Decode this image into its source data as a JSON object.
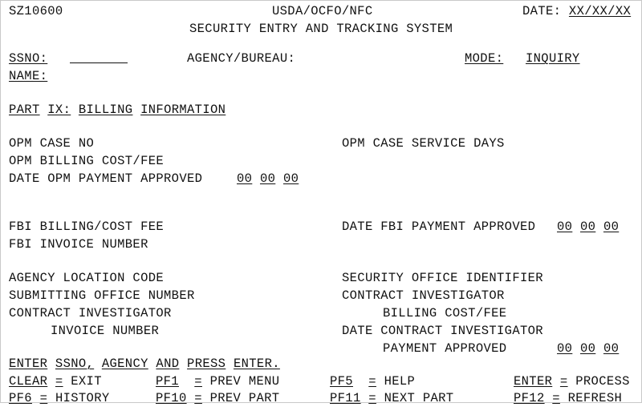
{
  "screen": {
    "program_id": "SZ10600",
    "agency_heading": "USDA/OCFO/NFC",
    "system_title": "SECURITY ENTRY AND TRACKING SYSTEM",
    "date_label": "DATE:",
    "date_value": "XX/XX/XX"
  },
  "keyfields": {
    "ssno_label": "SSNO:",
    "ssno_value": "",
    "name_label": "NAME:",
    "name_value": "",
    "agency_bureau_label": "AGENCY/BUREAU:",
    "agency_bureau_value": "",
    "mode_label": "MODE:",
    "mode_value": "INQUIRY"
  },
  "part": {
    "word1": "PART",
    "word2": "IX:",
    "word3": "BILLING",
    "word4": "INFORMATION"
  },
  "opm": {
    "case_no_label": "OPM CASE NO",
    "case_no_value": "",
    "service_days_label": "OPM CASE SERVICE DAYS",
    "service_days_value": "",
    "billing_cost_fee_label": "OPM BILLING COST/FEE",
    "billing_cost_fee_value": "",
    "date_payment_approved_label": "DATE OPM PAYMENT APPROVED",
    "date_mm": "00",
    "date_dd": "00",
    "date_yy": "00"
  },
  "fbi": {
    "billing_cost_fee_label": "FBI BILLING/COST FEE",
    "billing_cost_fee_value": "",
    "invoice_number_label": "FBI INVOICE NUMBER",
    "invoice_number_value": "",
    "date_payment_approved_label": "DATE FBI PAYMENT APPROVED",
    "date_mm": "00",
    "date_dd": "00",
    "date_yy": "00"
  },
  "agency": {
    "location_code_label": "AGENCY LOCATION CODE",
    "location_code_value": "",
    "submitting_office_number_label": "SUBMITTING OFFICE NUMBER",
    "submitting_office_number_value": "",
    "contract_investigator_label": "CONTRACT INVESTIGATOR",
    "contract_investigator_invoice_label": "INVOICE NUMBER",
    "contract_investigator_invoice_value": ""
  },
  "security": {
    "office_identifier_label": "SECURITY OFFICE IDENTIFIER",
    "office_identifier_value": "",
    "contract_investigator_label": "CONTRACT INVESTIGATOR",
    "contract_investigator_billing_label": "BILLING COST/FEE",
    "contract_investigator_billing_value": "",
    "date_contract_investigator_label": "DATE CONTRACT INVESTIGATOR",
    "payment_approved_label": "PAYMENT APPROVED",
    "date_mm": "00",
    "date_dd": "00",
    "date_yy": "00"
  },
  "instruction": {
    "w1": "ENTER",
    "w2": "SSNO,",
    "w3": "AGENCY",
    "w4": "AND",
    "w5": "PRESS",
    "w6": "ENTER."
  },
  "function_keys": {
    "eq": "=",
    "row1": [
      {
        "key": "CLEAR",
        "action": "EXIT"
      },
      {
        "key": "PF1",
        "action": "PREV MENU"
      },
      {
        "key": "PF5",
        "action": "HELP"
      },
      {
        "key": "ENTER",
        "action": "PROCESS"
      }
    ],
    "row2": [
      {
        "key": "PF6",
        "action": "HISTORY"
      },
      {
        "key": "PF10",
        "action": "PREV PART"
      },
      {
        "key": "PF11",
        "action": "NEXT PART"
      },
      {
        "key": "PF12",
        "action": "REFRESH"
      }
    ]
  }
}
